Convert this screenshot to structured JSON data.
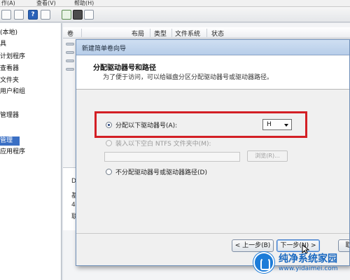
{
  "menubar": {
    "items": [
      "作(A)",
      "查看(V)",
      "帮助(H)"
    ]
  },
  "toolbar": {
    "help_glyph": "?"
  },
  "tree": {
    "items": [
      "(本地)",
      "具",
      "计划程序",
      "查看器",
      "文件夹",
      "用户和组",
      "",
      "管理器",
      "",
      "管理",
      "应用程序"
    ],
    "selected_index": 9
  },
  "list_header": {
    "columns": [
      "卷",
      "布局",
      "类型",
      "文件系统",
      "状态"
    ]
  },
  "lower_panel": {
    "fragments": [
      "D",
      "基",
      "4",
      "联"
    ]
  },
  "dialog": {
    "title": "新建简单卷向导",
    "header_title": "分配驱动器号和路径",
    "header_subtitle": "为了便于访问，可以给磁盘分区分配驱动器号或驱动器路径。",
    "option_assign_letter": "分配以下驱动器号(A):",
    "drive_letter_value": "H",
    "option_mount_folder": "装入以下空白 NTFS 文件夹中(M):",
    "browse_label": "浏览(R)...",
    "option_no_letter": "不分配驱动器号或驱动器路径(D)",
    "back_button": "< 上一步(B)",
    "next_button": "下一步(N) >",
    "cancel_button": "取"
  },
  "watermark": {
    "name": "纯净系统家园",
    "url": "www.yidaimei.com"
  },
  "colors": {
    "highlight": "#d31f25",
    "watermark": "#1767c0",
    "title_bar": "#b7cde9"
  }
}
